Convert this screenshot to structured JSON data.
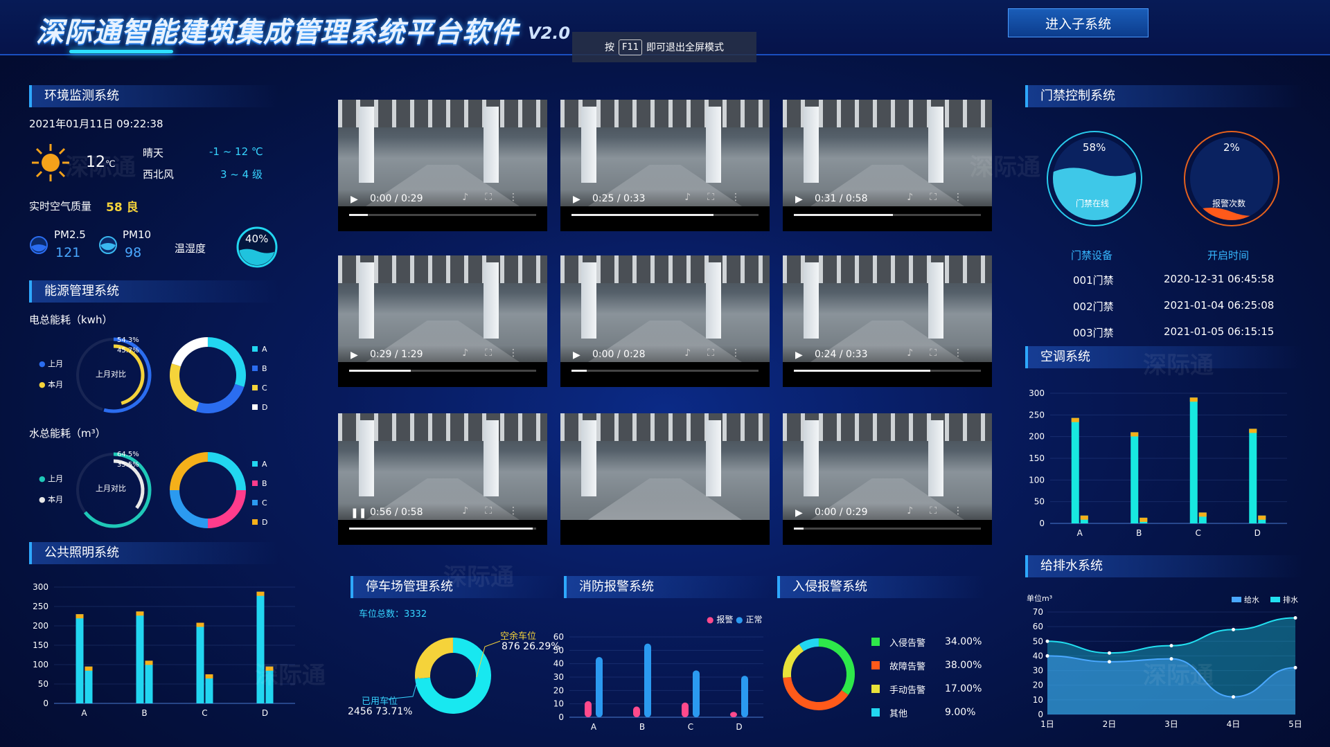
{
  "header": {
    "title": "深际通智能建筑集成管理系统平台软件",
    "version": "V2.0",
    "f11_prefix": "按",
    "f11_key": "F11",
    "f11_suffix": "即可退出全屏模式",
    "enter_button": "进入子系统"
  },
  "env": {
    "title": "环境监测系统",
    "datetime": "2021年01月11日 09:22:38",
    "temp": "12",
    "temp_unit": "℃",
    "weather": "晴天",
    "wind": "西北风",
    "temp_range": "-1 ~ 12 ℃",
    "wind_level": "3 ~ 4 级",
    "air_label": "实时空气质量",
    "air_value": "58 良",
    "pm25_label": "PM2.5",
    "pm25_value": "121",
    "pm10_label": "PM10",
    "pm10_value": "98",
    "humidity_label": "温湿度",
    "humidity_value": "40%",
    "humidity_fraction": 0.4
  },
  "energy": {
    "title": "能源管理系统",
    "elec_label": "电总能耗（kwh）",
    "water_label": "水总能耗（m³）",
    "compare_label": "上月对比",
    "last_month": "上月",
    "this_month": "本月",
    "elec_pct1": "54.3%",
    "elec_pct2": "45.7%",
    "water_pct1": "64.5%",
    "water_pct2": "35.5%",
    "legend": [
      "A",
      "B",
      "C",
      "D"
    ]
  },
  "lighting": {
    "title": "公共照明系统"
  },
  "videos": [
    {
      "time": "0:00 / 0:29",
      "progress": 0.1,
      "state": "play"
    },
    {
      "time": "0:25 / 0:33",
      "progress": 0.76,
      "state": "play"
    },
    {
      "time": "0:31 / 0:58",
      "progress": 0.53,
      "state": "play"
    },
    {
      "time": "0:29 / 1:29",
      "progress": 0.33,
      "state": "play"
    },
    {
      "time": "0:00 / 0:28",
      "progress": 0.08,
      "state": "play"
    },
    {
      "time": "0:24 / 0:33",
      "progress": 0.73,
      "state": "play"
    },
    {
      "time": "0:56 / 0:58",
      "progress": 0.98,
      "state": "pause"
    },
    {
      "time": "",
      "progress": 0,
      "state": "none"
    },
    {
      "time": "0:00 / 0:29",
      "progress": 0.05,
      "state": "play"
    }
  ],
  "parking": {
    "title": "停车场管理系统",
    "total_label": "车位总数：3332",
    "free_label": "空余车位",
    "free_value": "876  26.29%",
    "used_label": "已用车位",
    "used_value": "2456  73.71%"
  },
  "fire": {
    "title": "消防报警系统",
    "legend_alarm": "报警",
    "legend_normal": "正常"
  },
  "intrusion": {
    "title": "入侵报警系统",
    "items": [
      {
        "name": "入侵告警",
        "pct": "34.00%",
        "color": "#2ee84a"
      },
      {
        "name": "故障告警",
        "pct": "38.00%",
        "color": "#ff5a1a"
      },
      {
        "name": "手动告警",
        "pct": "17.00%",
        "color": "#e8e23a"
      },
      {
        "name": "其他",
        "pct": "9.00%",
        "color": "#22d6f0"
      }
    ]
  },
  "access": {
    "title": "门禁控制系统",
    "online_pct": "58%",
    "online_label": "门禁在线",
    "online_fraction": 0.58,
    "alarm_pct": "2%",
    "alarm_label": "报警次数",
    "alarm_fraction": 0.02,
    "col1": "门禁设备",
    "col2": "开启时间",
    "rows": [
      {
        "device": "001门禁",
        "time": "2020-12-31 06:45:58"
      },
      {
        "device": "002门禁",
        "time": "2021-01-04 06:25:08"
      },
      {
        "device": "003门禁",
        "time": "2021-01-05 06:15:15"
      }
    ]
  },
  "ac": {
    "title": "空调系统"
  },
  "water": {
    "title": "给排水系统"
  },
  "watermark": "深际通",
  "chart_data": [
    {
      "type": "pie",
      "title": "",
      "slices": [
        {
          "label": "上月",
          "value": 54.3,
          "color": "#2b6df0"
        },
        {
          "label": "本月",
          "value": 45.7,
          "color": "#f5d33a"
        }
      ]
    },
    {
      "type": "pie",
      "title": "",
      "slices": [
        {
          "label": "A",
          "value": 30,
          "color": "#22d6f0"
        },
        {
          "label": "B",
          "value": 25,
          "color": "#2b6df0"
        },
        {
          "label": "C",
          "value": 25,
          "color": "#f5d33a"
        },
        {
          "label": "D",
          "value": 20,
          "color": "#ffffff"
        }
      ]
    },
    {
      "type": "pie",
      "title": "",
      "slices": [
        {
          "label": "上月",
          "value": 64.5,
          "color": "#1fc8b8"
        },
        {
          "label": "本月",
          "value": 35.5,
          "color": "#e8e8e8"
        }
      ]
    },
    {
      "type": "pie",
      "title": "",
      "slices": [
        {
          "label": "A",
          "value": 25,
          "color": "#22d6f0"
        },
        {
          "label": "B",
          "value": 25,
          "color": "#ff3c8c"
        },
        {
          "label": "C",
          "value": 25,
          "color": "#2b9af0"
        },
        {
          "label": "D",
          "value": 25,
          "color": "#f5b01a"
        }
      ]
    },
    {
      "type": "bar",
      "title": "",
      "categories": [
        "A",
        "B",
        "C",
        "D"
      ],
      "series": [
        {
          "values": [
            230,
            237,
            208,
            288
          ],
          "color": "#22d6f0",
          "top": "#f5b01a"
        },
        {
          "values": [
            95,
            110,
            75,
            95
          ],
          "color": "#22d6f0",
          "top": "#f5b01a"
        }
      ],
      "ylim": [
        0,
        300
      ],
      "yticks": [
        0,
        50,
        100,
        150,
        200,
        250,
        300
      ]
    },
    {
      "type": "pie",
      "title": "",
      "slices": [
        {
          "label": "已用车位",
          "value": 73.71,
          "color": "#18e8f0"
        },
        {
          "label": "空余车位",
          "value": 26.29,
          "color": "#f5d33a"
        }
      ]
    },
    {
      "type": "bar",
      "title": "",
      "categories": [
        "A",
        "B",
        "C",
        "D"
      ],
      "series": [
        {
          "name": "报警",
          "values": [
            12,
            8,
            11,
            4
          ],
          "color": "#ff4a8c"
        },
        {
          "name": "正常",
          "values": [
            45,
            55,
            35,
            31
          ],
          "color": "#2b9af0"
        }
      ],
      "ylim": [
        0,
        60
      ],
      "yticks": [
        0,
        10,
        20,
        30,
        40,
        50,
        60
      ]
    },
    {
      "type": "pie",
      "title": "",
      "slices": [
        {
          "label": "入侵告警",
          "value": 34,
          "color": "#2ee84a"
        },
        {
          "label": "故障告警",
          "value": 38,
          "color": "#ff5a1a"
        },
        {
          "label": "手动告警",
          "value": 17,
          "color": "#e8e23a"
        },
        {
          "label": "其他",
          "value": 9,
          "color": "#22d6f0"
        }
      ]
    },
    {
      "type": "bar",
      "title": "",
      "categories": [
        "A",
        "B",
        "C",
        "D"
      ],
      "series": [
        {
          "values": [
            243,
            210,
            290,
            218
          ],
          "color": "#18e8e0",
          "top": "#f5b01a"
        },
        {
          "values": [
            18,
            13,
            25,
            18
          ],
          "color": "#18e8e0",
          "top": "#f5b01a"
        }
      ],
      "ylim": [
        0,
        300
      ],
      "yticks": [
        0,
        50,
        100,
        150,
        200,
        250,
        300
      ]
    },
    {
      "type": "area",
      "title": "",
      "ylabel": "单位m³",
      "categories": [
        "1日",
        "2日",
        "3日",
        "4日",
        "5日"
      ],
      "series": [
        {
          "name": "给水",
          "values": [
            40,
            36,
            38,
            12,
            32
          ],
          "color": "#4aa8ff"
        },
        {
          "name": "排水",
          "values": [
            50,
            42,
            47,
            58,
            66
          ],
          "color": "#22e0f0"
        }
      ],
      "ylim": [
        0,
        70
      ],
      "yticks": [
        0,
        10,
        20,
        30,
        40,
        50,
        60,
        70
      ]
    }
  ]
}
